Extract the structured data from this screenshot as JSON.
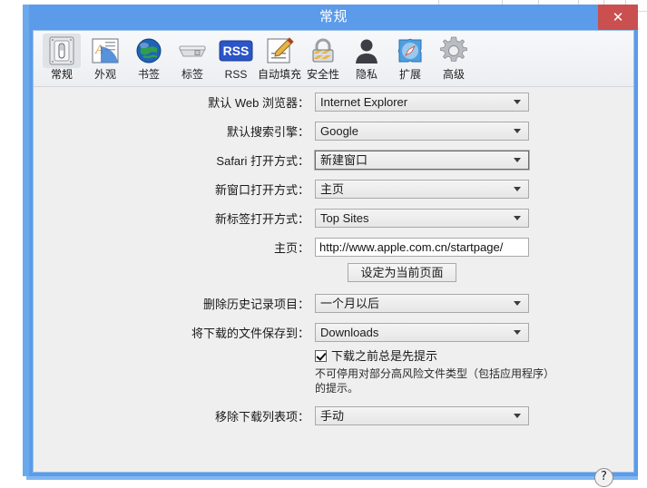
{
  "window": {
    "title": "常规",
    "close_label": "✕"
  },
  "toolbar": {
    "items": [
      {
        "label": "常规",
        "icon": "switch-plate-icon",
        "selected": true
      },
      {
        "label": "外观",
        "icon": "appearance-icon",
        "selected": false
      },
      {
        "label": "书签",
        "icon": "globe-icon",
        "selected": false
      },
      {
        "label": "标签",
        "icon": "tab-icon",
        "selected": false
      },
      {
        "label": "RSS",
        "icon": "rss-icon",
        "selected": false
      },
      {
        "label": "自动填充",
        "icon": "autofill-pencil-icon",
        "selected": false
      },
      {
        "label": "安全性",
        "icon": "padlock-icon",
        "selected": false
      },
      {
        "label": "隐私",
        "icon": "person-silhouette-icon",
        "selected": false
      },
      {
        "label": "扩展",
        "icon": "puzzle-compass-icon",
        "selected": false
      },
      {
        "label": "高级",
        "icon": "gear-icon",
        "selected": false
      }
    ]
  },
  "form": {
    "default_browser": {
      "label": "默认 Web 浏览器：",
      "value": "Internet Explorer"
    },
    "default_search": {
      "label": "默认搜索引擎：",
      "value": "Google"
    },
    "safari_opens": {
      "label": "Safari 打开方式：",
      "value": "新建窗口"
    },
    "new_window_opens": {
      "label": "新窗口打开方式：",
      "value": "主页"
    },
    "new_tab_opens": {
      "label": "新标签打开方式：",
      "value": "Top Sites"
    },
    "homepage": {
      "label": "主页：",
      "value": "http://www.apple.com.cn/startpage/",
      "set_current_label": "设定为当前页面"
    },
    "remove_history": {
      "label": "删除历史记录项目：",
      "value": "一个月以后"
    },
    "download_location": {
      "label": "将下载的文件保存到：",
      "value": "Downloads"
    },
    "always_prompt": {
      "label": "下载之前总是先提示",
      "checked": true,
      "hint": "不可停用对部分高风险文件类型（包括应用程序）的提示。"
    },
    "remove_download_items": {
      "label": "移除下载列表项：",
      "value": "手动"
    }
  },
  "help": {
    "label": "?"
  },
  "colors": {
    "window_frame": "#5b9bea",
    "close_button": "#c9504f",
    "client_background": "#efefef",
    "toolbar_background": "#f2f4f6"
  }
}
